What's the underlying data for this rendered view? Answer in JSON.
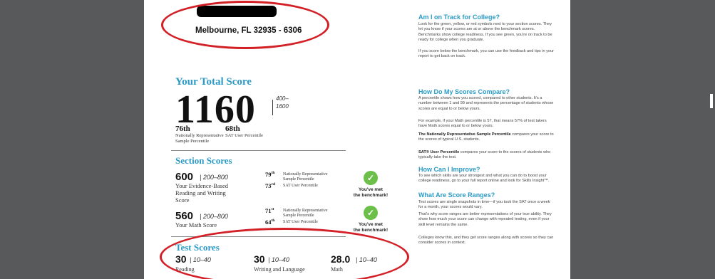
{
  "report": {
    "address": "Melbourne, FL 32935 - 6306",
    "total": {
      "heading": "Your Total Score",
      "score": "1160",
      "range_low": "400–",
      "range_high": "1600",
      "nat_pct": "76",
      "nat_pct_suffix": "th",
      "nat_label_1": "Nationally Representative",
      "nat_label_2": "Sample Percentile",
      "user_pct": "68",
      "user_pct_suffix": "th",
      "user_label": "SAT User Percentile"
    },
    "section": {
      "heading": "Section Scores",
      "items": [
        {
          "score": "600",
          "range": "| 200–800",
          "label_1": "Your Evidence-Based",
          "label_2": "Reading and Writing",
          "label_3": "Score",
          "nat_pct": "79",
          "nat_suffix": "th",
          "nat_label_1": "Nationally Representative",
          "nat_label_2": "Sample Percentile",
          "user_pct": "73",
          "user_suffix": "rd",
          "user_label": "SAT User Percentile",
          "bench_1": "You've met",
          "bench_2": "the benchmark!"
        },
        {
          "score": "560",
          "range": "| 200–800",
          "label_1": "Your Math Score",
          "nat_pct": "71",
          "nat_suffix": "st",
          "nat_label_1": "Nationally Representative",
          "nat_label_2": "Sample Percentile",
          "user_pct": "64",
          "user_suffix": "th",
          "user_label": "SAT User Percentile",
          "bench_1": "You've met",
          "bench_2": "the benchmark!"
        }
      ]
    },
    "test": {
      "heading": "Test Scores",
      "items": [
        {
          "score": "30",
          "range": "| 10–40",
          "label": "Reading"
        },
        {
          "score": "30",
          "range": "| 10–40",
          "label": "Writing and Language"
        },
        {
          "score": "28.0",
          "range": "| 10–40",
          "label": "Math"
        }
      ]
    }
  },
  "sidebar": {
    "track_heading": "Am I on Track for College?",
    "track_p1": "Look for the green, yellow, or red symbols next to your section scores. They let you know if your scores are at or above the benchmark scores. Benchmarks show college readiness. If you see green, you're on track to be ready for college when you graduate.",
    "track_p2": "If you score below the benchmark, you can use the feedback and tips in your report to get back on track.",
    "compare_heading": "How Do My Scores Compare?",
    "compare_p1": "A percentile shows how you scored, compared to other students. It's a number between 1 and 99 and represents the percentage of students whose scores are equal to or below yours.",
    "compare_p2": "For example, if your Math percentile is 57, that means 57% of test takers have Math scores equal to or below yours.",
    "compare_p3_bold": "The Nationally Representative Sample Percentile",
    "compare_p3": "compares your score to the scores of typical U.S. students.",
    "compare_p4_bold": "SAT® User Percentile",
    "compare_p4": "compares your score to the scores of students who typically take the test.",
    "improve_heading": "How Can I Improve?",
    "improve_p1": "To see which skills are your strongest and what you can do to boost your college readiness, go to your full report online and look for Skills Insight™.",
    "ranges_heading": "What Are Score Ranges?",
    "ranges_p1": "Test scores are single snapshots in time—if you took the SAT once a week for a month, your scores would vary.",
    "ranges_p2": "That's why score ranges are better representations of your true ability. They show how much your score can change with repeated testing, even if your skill level remains the same.",
    "ranges_p3": "Colleges know this, and they get score ranges along with scores so they can consider scores in context."
  },
  "colors": {
    "accent": "#2a9bc7",
    "annotation": "#d31f26",
    "check": "#6cc04a",
    "viewer_bg": "#58595b"
  }
}
